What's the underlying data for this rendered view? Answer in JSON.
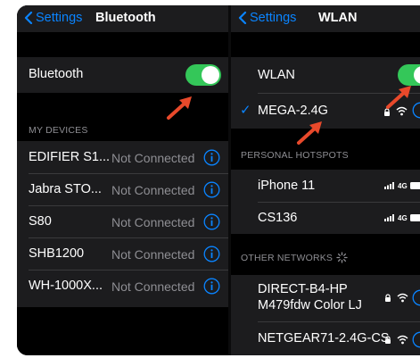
{
  "left": {
    "back_label": "Settings",
    "title": "Bluetooth",
    "toggle_label": "Bluetooth",
    "section_header": "MY DEVICES",
    "devices": [
      {
        "name": "EDIFIER S1...",
        "status": "Not Connected"
      },
      {
        "name": "Jabra STO...",
        "status": "Not Connected"
      },
      {
        "name": "S80",
        "status": "Not Connected"
      },
      {
        "name": "SHB1200",
        "status": "Not Connected"
      },
      {
        "name": "WH-1000X...",
        "status": "Not Connected"
      }
    ]
  },
  "right": {
    "back_label": "Settings",
    "title": "WLAN",
    "toggle_label": "WLAN",
    "connected_network": "MEGA-2.4G",
    "hotspots_header": "PERSONAL HOTSPOTS",
    "hotspots": [
      {
        "name": "iPhone 11",
        "signal": "4G"
      },
      {
        "name": "CS136",
        "signal": "4G"
      }
    ],
    "other_header": "OTHER NETWORKS",
    "other_networks": [
      {
        "name_line1": "DIRECT-B4-HP",
        "name_line2": "M479fdw Color LJ"
      },
      {
        "name_line1": "NETGEAR71-2.4G-CS",
        "name_line2": ""
      }
    ]
  },
  "colors": {
    "accent": "#0a84ff",
    "toggle_on": "#34c759",
    "annotation_arrow": "#e8492b",
    "cell_bg": "#1c1c1e",
    "secondary_text": "#8e8e93"
  },
  "icons": [
    "chevron-left-icon",
    "info-icon",
    "checkmark-icon",
    "lock-icon",
    "wifi-icon",
    "cellular-signal-icon",
    "battery-icon",
    "spinner-icon",
    "annotation-arrow"
  ]
}
